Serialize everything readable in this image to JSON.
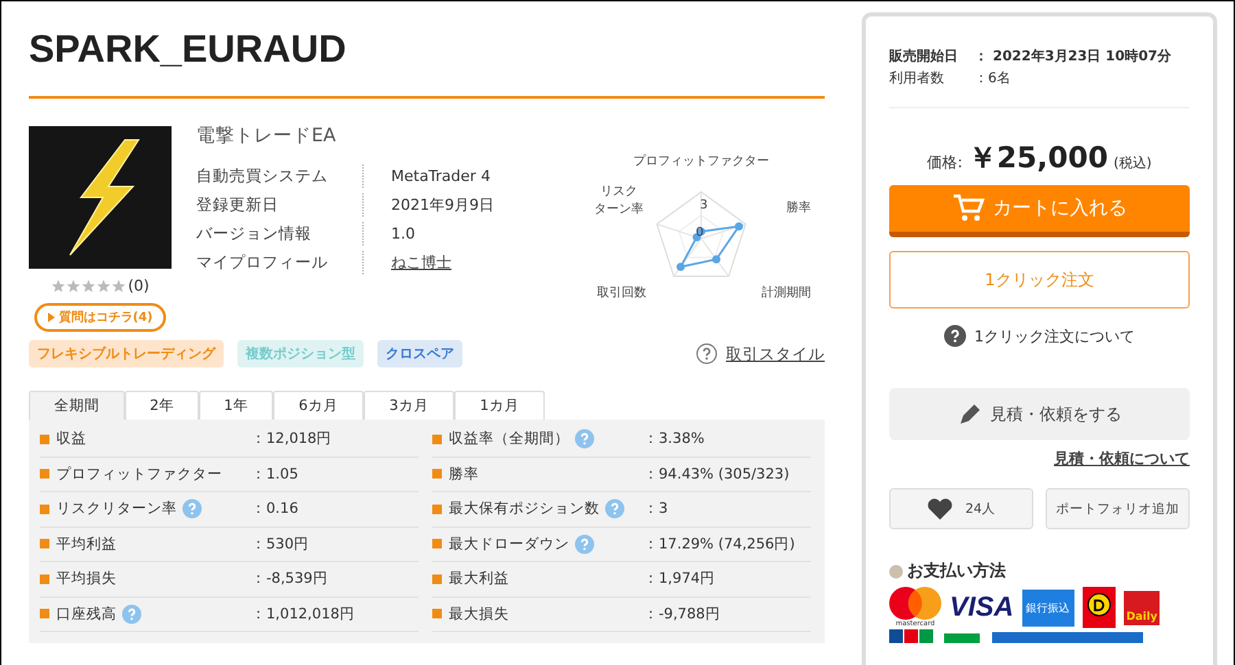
{
  "title": "SPARK_EURAUD",
  "product": {
    "name": "電撃トレードEA",
    "stars": 0,
    "review_count": "(0)",
    "question_button": "質問はコチラ(4)",
    "info": [
      {
        "label": "自動売買システム",
        "value": "MetaTrader 4",
        "kind": "text"
      },
      {
        "label": "登録更新日",
        "value": "2021年9月9日",
        "kind": "text"
      },
      {
        "label": "バージョン情報",
        "value": "1.0",
        "kind": "text"
      },
      {
        "label": "マイプロフィール",
        "value": "ねこ博士",
        "kind": "link"
      }
    ]
  },
  "radar": {
    "labels": [
      [
        "プロフィットファクター"
      ],
      [
        "勝率"
      ],
      [
        "計測期間"
      ],
      [
        "取引回数"
      ],
      [
        "リスク",
        "ターン率"
      ]
    ],
    "scale_labels": [
      "3",
      "0"
    ]
  },
  "tags": [
    {
      "label": "フレキシブルトレーディング",
      "color": "#ffe4cc"
    },
    {
      "label": "複数ポジション型",
      "color": "#dff3f3"
    },
    {
      "label": "クロスペア",
      "color": "#dde8f7"
    }
  ],
  "style_link": "取引スタイル",
  "tabs": [
    {
      "label": "全期間",
      "selected": true
    },
    {
      "label": "2年",
      "selected": false
    },
    {
      "label": "1年",
      "selected": false
    },
    {
      "label": "6カ月",
      "selected": false
    },
    {
      "label": "3カ月",
      "selected": false
    },
    {
      "label": "1カ月",
      "selected": false
    }
  ],
  "stats": [
    {
      "label": "収益",
      "value": "：12,018円",
      "help": false
    },
    {
      "label": "収益率（全期間）",
      "value": "：3.38%",
      "help": true
    },
    {
      "label": "プロフィットファクター",
      "value": "：1.05",
      "help": false
    },
    {
      "label": "勝率",
      "value": "：94.43% (305/323)",
      "help": false
    },
    {
      "label": "リスクリターン率",
      "value": "：0.16",
      "help": true
    },
    {
      "label": "最大保有ポジション数",
      "value": "：3",
      "help": true
    },
    {
      "label": "平均利益",
      "value": "：530円",
      "help": false
    },
    {
      "label": "最大ドローダウン",
      "value": "：17.29% (74,256円)",
      "help": true
    },
    {
      "label": "平均損失",
      "value": "：-8,539円",
      "help": false
    },
    {
      "label": "最大利益",
      "value": "：1,974円",
      "help": false
    },
    {
      "label": "口座残高",
      "value": "：1,012,018円",
      "help": true
    },
    {
      "label": "最大損失",
      "value": "：-9,788円",
      "help": false
    }
  ],
  "sidebar": {
    "meta": [
      {
        "label": "販売開始日",
        "value": "：  2022年3月23日 10時07分",
        "bold": true
      },
      {
        "label": "利用者数",
        "value": "：6名",
        "bold": false
      }
    ],
    "price_label": "価格:",
    "price": "￥25,000",
    "tax": "(税込)",
    "cart_button": "カートに入れる",
    "one_click_button": "1クリック注文",
    "one_click_help": "1クリック注文について",
    "quote_button": "見積・依頼をする",
    "quote_link": "見積・依頼について",
    "like_count": "24人",
    "portfolio_button": "ポートフォリオ追加",
    "payment_title": "お支払い方法",
    "payments": [
      {
        "kind": "mastercard",
        "label": "mastercard"
      },
      {
        "kind": "visa",
        "label": "VISA"
      },
      {
        "kind": "bank",
        "label": "銀行振込"
      },
      {
        "kind": "dpoint"
      },
      {
        "kind": "daily",
        "label": "Daily"
      }
    ]
  }
}
